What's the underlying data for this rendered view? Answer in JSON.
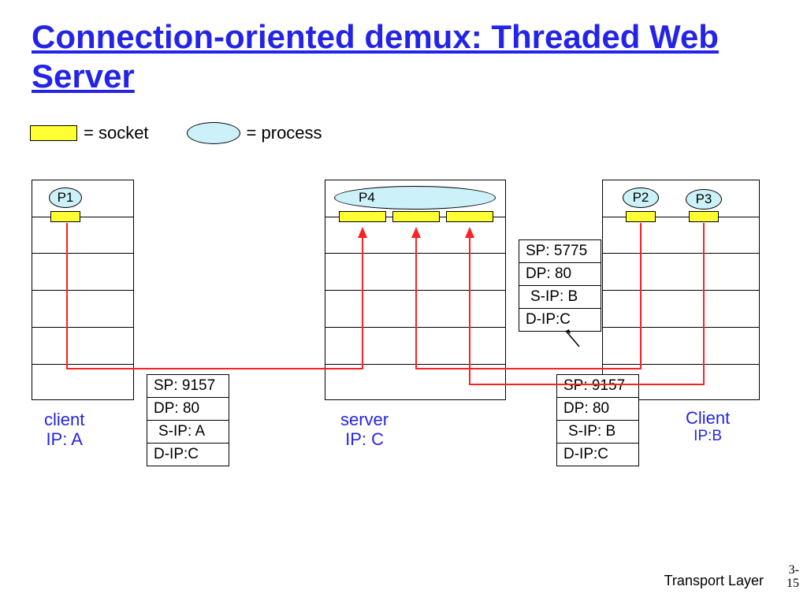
{
  "title": "Connection-oriented demux: Threaded Web Server",
  "legend": {
    "socket": "= socket",
    "process": "= process"
  },
  "processes": {
    "p1": "P1",
    "p2": "P2",
    "p3": "P3",
    "p4": "P4"
  },
  "hosts": {
    "a": {
      "l1": "client",
      "l2": "IP: A"
    },
    "c": {
      "l1": "server",
      "l2": "IP: C"
    },
    "b": {
      "l1": "Client",
      "l2": "IP:B"
    }
  },
  "packets": {
    "left": {
      "sp": "SP: 9157",
      "dp": "DP: 80",
      "sip": "S-IP: A",
      "dip": "D-IP:C"
    },
    "middle": {
      "sp": "SP: 5775",
      "dp": "DP: 80",
      "sip": "S-IP: B",
      "dip": "D-IP:C"
    },
    "right": {
      "sp": "SP: 9157",
      "dp": "DP: 80",
      "sip": "S-IP: B",
      "dip": "D-IP:C"
    }
  },
  "footer": "Transport Layer",
  "page": {
    "a": "3-",
    "b": "15"
  }
}
